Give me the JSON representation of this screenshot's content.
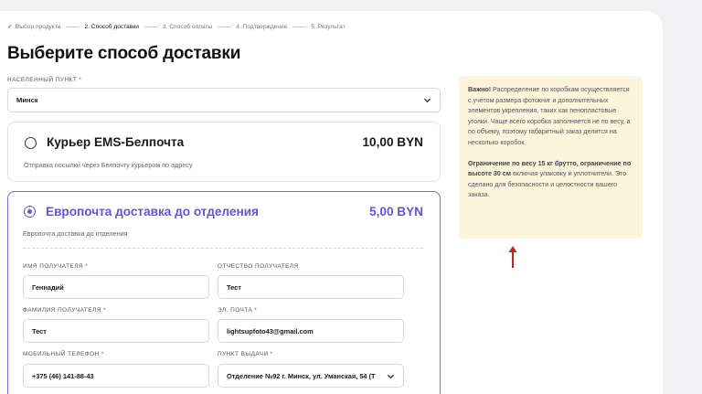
{
  "steps": [
    {
      "label": "Выбор продукта",
      "state": "done"
    },
    {
      "label": "2. Способ доставки",
      "state": "active"
    },
    {
      "label": "3. Способ оплаты",
      "state": "pending"
    },
    {
      "label": "4. Подтверждение",
      "state": "pending"
    },
    {
      "label": "5. Результат",
      "state": "pending"
    }
  ],
  "page_title": "Выберите способ доставки",
  "city": {
    "label": "НАСЕЛЕННЫЙ ПУНКТ",
    "value": "Минск"
  },
  "option1": {
    "title": "Курьер EMS-Белпочта",
    "price": "10,00 BYN",
    "desc": "Отправка посылки через Белпочту курьером по адресу",
    "selected": false
  },
  "option2": {
    "title": "Европочта доставка до отделения",
    "price": "5,00 BYN",
    "desc": "Европочта доставка до отделения",
    "selected": true
  },
  "form": {
    "first_name": {
      "label": "ИМЯ ПОЛУЧАТЕЛЯ",
      "value": "Геннадий"
    },
    "patronymic": {
      "label": "ОТЧЕСТВО ПОЛУЧАТЕЛЯ",
      "value": "Тест"
    },
    "last_name": {
      "label": "ФАМИЛИЯ ПОЛУЧАТЕЛЯ",
      "value": "Тест"
    },
    "email": {
      "label": "ЭЛ. ПОЧТА",
      "value": "lightsupfoto43@gmail.com"
    },
    "phone": {
      "label": "МОБИЛЬНЫЙ ТЕЛЕФОН",
      "value": "+375 (46) 141-88-43"
    },
    "pickup": {
      "label": "ПУНКТ ВЫДАЧИ",
      "value": "Отделение №92 г. Минск, ул. Уманская, 54 (Т"
    }
  },
  "note": {
    "p1_bold": "Важно!",
    "p1_text": " Распределение по коробкам осуществляется с учетом размера фотокниг и дополнительных элементов укрепления, таких как пенопластовые уголки. Чаще всего коробка заполняется не по весу, а по объему, поэтому габаритный заказ делится на несколько коробок.",
    "p2_bold": "Ограничение по весу 15 кг брутто, ограничение по высоте 30 см",
    "p2_text": " включая упаковку и уплотнители. Это сделано для безопасности и целостности вашего заказа."
  },
  "colors": {
    "accent": "#6b4fd8",
    "note_bg": "#fdf4dc",
    "required": "#e0262b",
    "arrow": "#cc1f1f"
  },
  "icons": {
    "step_done": "check-icon",
    "select": "chevron-down-icon",
    "annotation": "red-arrow-up-icon"
  }
}
